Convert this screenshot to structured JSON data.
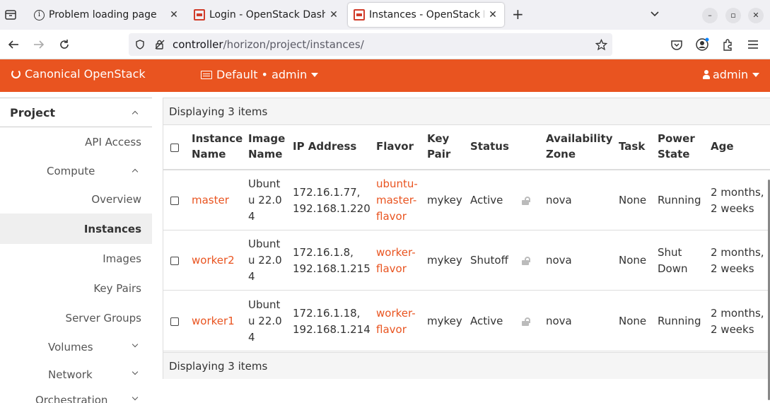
{
  "browser": {
    "tabs": [
      {
        "title": "Problem loading page",
        "icon": "info-icon"
      },
      {
        "title": "Login - OpenStack Dashb",
        "icon": "openstack-icon"
      },
      {
        "title": "Instances - OpenStack Da",
        "icon": "openstack-icon"
      }
    ],
    "url_host": "controller",
    "url_path": "/horizon/project/instances/"
  },
  "header": {
    "brand": "Canonical OpenStack",
    "project": "Default • admin",
    "user": "admin",
    "accent": "#e95420"
  },
  "sidebar": {
    "section": "Project",
    "items": [
      {
        "label": "API Access"
      },
      {
        "label": "Compute"
      },
      {
        "label": "Overview"
      },
      {
        "label": "Instances"
      },
      {
        "label": "Images"
      },
      {
        "label": "Key Pairs"
      },
      {
        "label": "Server Groups"
      },
      {
        "label": "Volumes"
      },
      {
        "label": "Network"
      },
      {
        "label": "Orchestration"
      }
    ]
  },
  "table": {
    "display_count": "Displaying 3 items",
    "headers": {
      "name_1": "Instance",
      "name_2": "Name",
      "image_1": "Image",
      "image_2": "Name",
      "ip": "IP Address",
      "flavor": "Flavor",
      "keypair_1": "Key",
      "keypair_2": "Pair",
      "status": "Status",
      "az_1": "Availability",
      "az_2": "Zone",
      "task": "Task",
      "power_1": "Power",
      "power_2": "State",
      "age": "Age"
    },
    "rows": [
      {
        "name": "master",
        "image": [
          "Ubunt",
          "u 22.0",
          "4"
        ],
        "ip": [
          "172.16.1.77,",
          "192.168.1.220"
        ],
        "flavor": [
          "ubuntu-",
          "master-",
          "flavor"
        ],
        "keypair": "mykey",
        "status": "Active",
        "az": "nova",
        "task": "None",
        "power": [
          "Running"
        ],
        "age": [
          "2 months,",
          "2 weeks"
        ]
      },
      {
        "name": "worker2",
        "image": [
          "Ubunt",
          "u 22.0",
          "4"
        ],
        "ip": [
          "172.16.1.8,",
          "192.168.1.215"
        ],
        "flavor": [
          "worker-",
          "flavor"
        ],
        "keypair": "mykey",
        "status": "Shutoff",
        "az": "nova",
        "task": "None",
        "power": [
          "Shut",
          "Down"
        ],
        "age": [
          "2 months,",
          "2 weeks"
        ]
      },
      {
        "name": "worker1",
        "image": [
          "Ubunt",
          "u 22.0",
          "4"
        ],
        "ip": [
          "172.16.1.18,",
          "192.168.1.214"
        ],
        "flavor": [
          "worker-",
          "flavor"
        ],
        "keypair": "mykey",
        "status": "Active",
        "az": "nova",
        "task": "None",
        "power": [
          "Running"
        ],
        "age": [
          "2 months,",
          "2 weeks"
        ]
      }
    ]
  }
}
